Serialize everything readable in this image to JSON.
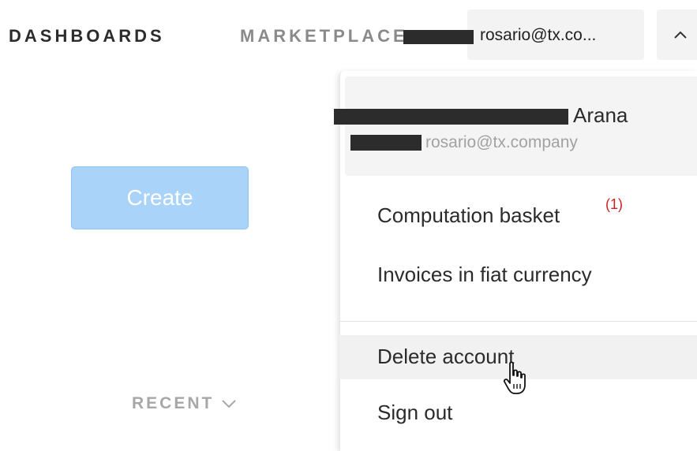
{
  "nav": {
    "dashboards": "DASHBOARDS",
    "marketplace": "MARKETPLACE"
  },
  "account": {
    "email": "rosario@tx.co...",
    "toggle_icon": "chevron-up-icon"
  },
  "main": {
    "create_label": "Create",
    "recent_label": "RECENT",
    "recent_icon": "chevron-down-icon"
  },
  "menu": {
    "name": "Arana",
    "email": "rosario@tx.company",
    "items": [
      {
        "label": "Computation basket",
        "badge": "(1)"
      },
      {
        "label": "Invoices in fiat currency"
      },
      {
        "label": "Delete account"
      },
      {
        "label": "Sign out"
      }
    ]
  },
  "colors": {
    "create_button": "#a9d3f8",
    "badge": "#cc2222",
    "nav_active": "#2c2c2c",
    "nav_inactive": "#8a8a8a"
  }
}
